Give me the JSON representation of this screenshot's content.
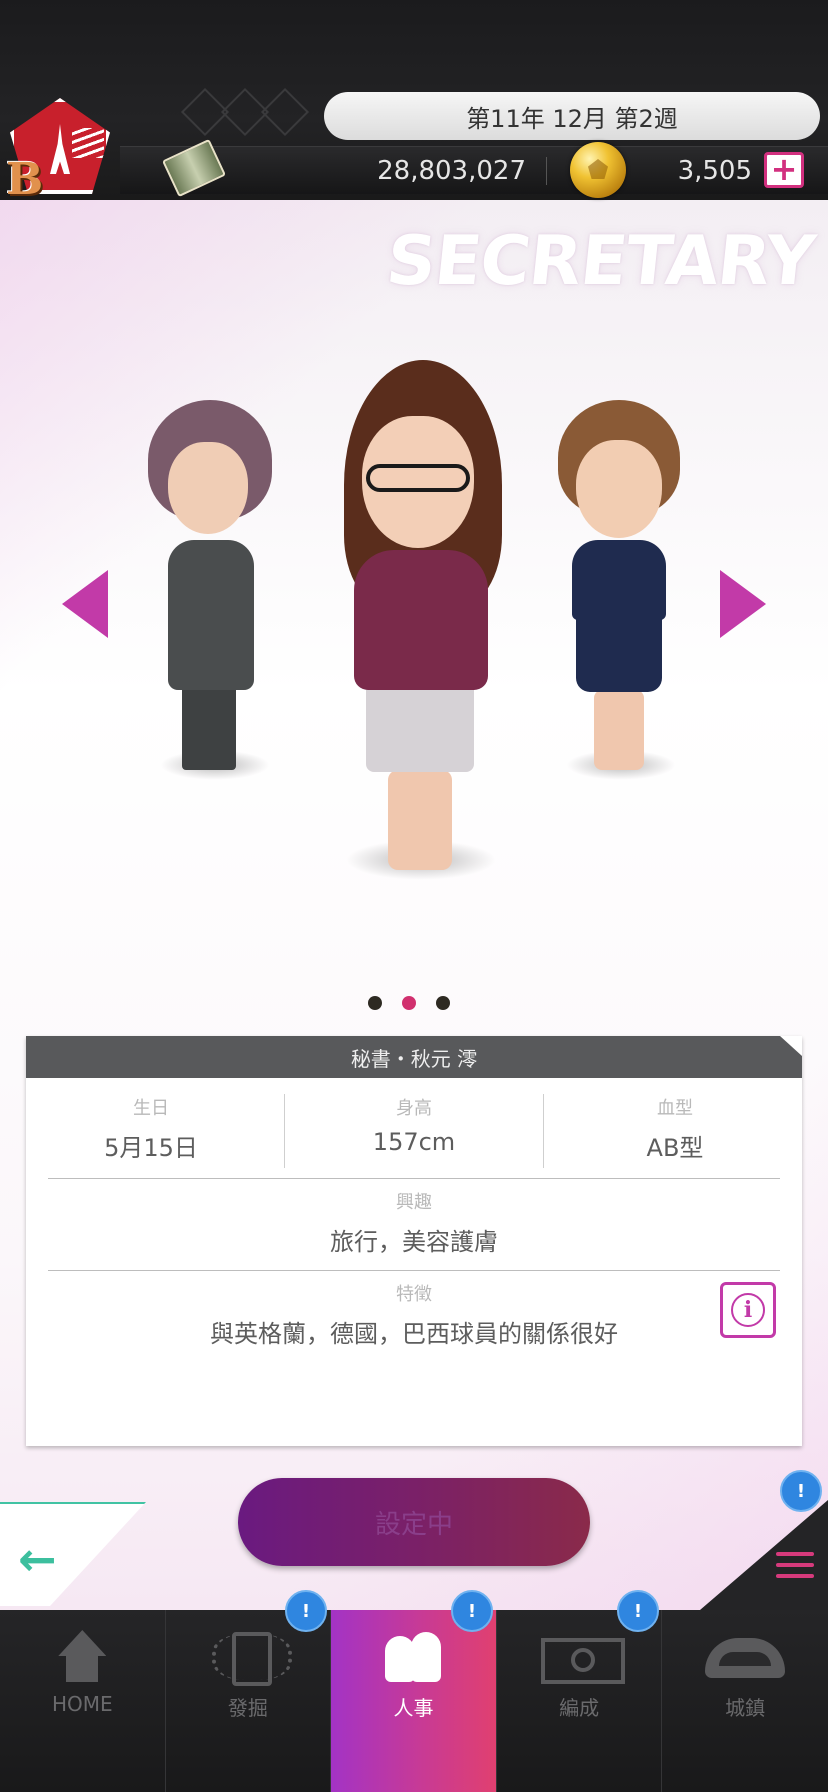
{
  "header": {
    "date": "第11年 12月 第2週",
    "money": "28,803,027",
    "coins": "3,505",
    "add_label": "+",
    "club_letter": "B"
  },
  "carousel": {
    "title": "SECRETARY",
    "page_count": 3,
    "active_index": 1
  },
  "profile": {
    "name": "秘書・秋元 澪",
    "birthday_label": "生日",
    "birthday": "5月15日",
    "height_label": "身高",
    "height": "157cm",
    "blood_label": "血型",
    "blood": "AB型",
    "hobby_label": "興趣",
    "hobby": "旅行，美容護膚",
    "trait_label": "特徵",
    "trait": "與英格蘭，德國，巴西球員的關係很好",
    "info_icon": "i"
  },
  "actions": {
    "back_icon": "←",
    "setting_label": "設定中",
    "notify": "!"
  },
  "nav": {
    "items": [
      {
        "label": "HOME",
        "icon": "home-icon"
      },
      {
        "label": "發掘",
        "icon": "scout-icon"
      },
      {
        "label": "人事",
        "icon": "staff-icon"
      },
      {
        "label": "編成",
        "icon": "formation-icon"
      },
      {
        "label": "城鎮",
        "icon": "stadium-icon"
      }
    ],
    "active": 2
  },
  "colors": {
    "accent": "#c23aa8",
    "active_tab_start": "#a333c5",
    "active_tab_end": "#e04070",
    "badge": "#2f86e0",
    "back_green": "#41c3a3"
  }
}
